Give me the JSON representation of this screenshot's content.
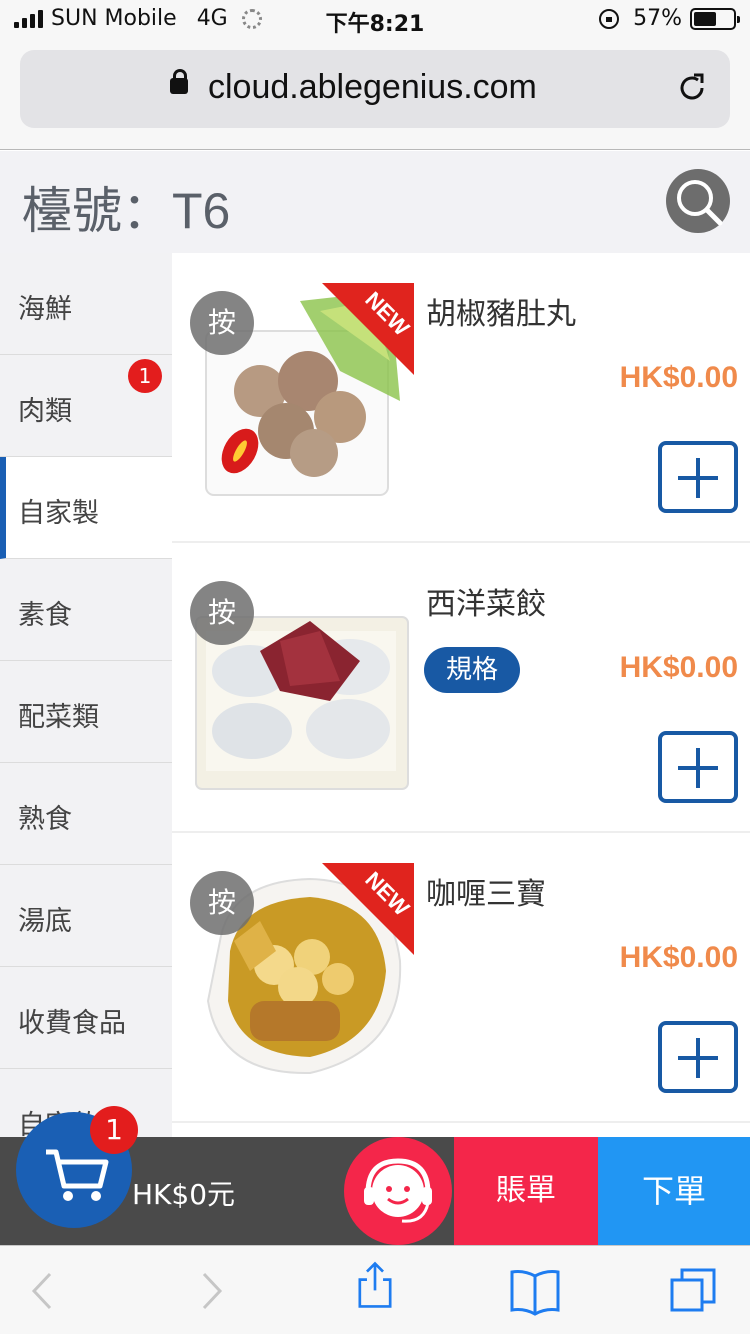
{
  "status_bar": {
    "carrier": "SUN Mobile",
    "network": "4G",
    "time": "下午8:21",
    "battery_text": "57%",
    "battery_level": 0.57
  },
  "browser": {
    "url": "cloud.ablegenius.com"
  },
  "header": {
    "title": "檯號：T6"
  },
  "sidebar": {
    "items": [
      {
        "label": "海鮮"
      },
      {
        "label": "肉類",
        "badge": "1"
      },
      {
        "label": "自家製",
        "active": true
      },
      {
        "label": "素食"
      },
      {
        "label": "配菜類"
      },
      {
        "label": "熟食"
      },
      {
        "label": "湯底"
      },
      {
        "label": "收費食品"
      },
      {
        "label": "自家飲"
      }
    ]
  },
  "tap_label": "按",
  "new_label": "NEW",
  "products": [
    {
      "name": "胡椒豬肚丸",
      "price": "HK$0.00",
      "is_new": true
    },
    {
      "name": "西洋菜餃",
      "price": "HK$0.00",
      "spec_label": "規格"
    },
    {
      "name": "咖喱三寶",
      "price": "HK$0.00",
      "is_new": true
    }
  ],
  "bottom_bar": {
    "cart_badge": "1",
    "total": "HK$0元",
    "bill_label": "賬單",
    "order_label": "下單"
  },
  "colors": {
    "accent_blue": "#1859a4",
    "price_orange": "#f08a4b",
    "badge_red": "#e31d1d",
    "bill_red": "#f4264a",
    "order_blue": "#2196f3"
  }
}
